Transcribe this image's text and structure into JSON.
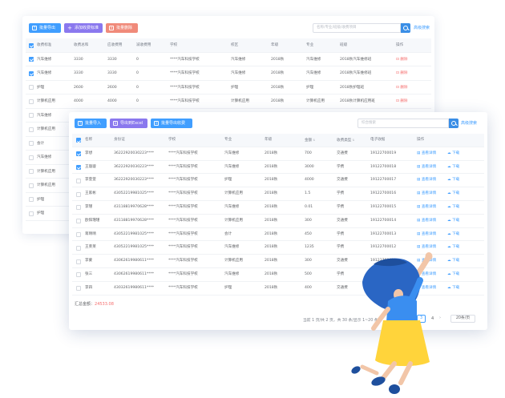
{
  "back_panel": {
    "toolbar": {
      "import_label": "批量导出",
      "add_label": "添加收费标准",
      "delete_label": "批量删除"
    },
    "search": {
      "placeholder": "名称/专业/班级/收费项目",
      "advanced_label": "高级搜索"
    },
    "columns": [
      "收费标准",
      "收费总和",
      "应收费用",
      "减收费用",
      "学校",
      "校区",
      "年级",
      "专业",
      "班级",
      "操作"
    ],
    "rows": [
      {
        "checked": true,
        "name": "汽车维修",
        "total": "3330",
        "due": "3330",
        "reduce": "0",
        "school": "****汽车科技学校",
        "campus": "汽车维修",
        "grade": "2018秋",
        "major": "汽车维修",
        "class": "2018秋汽车维修班",
        "action": "删除"
      },
      {
        "checked": true,
        "name": "汽车维修",
        "total": "3330",
        "due": "3330",
        "reduce": "0",
        "school": "****汽车科技学校",
        "campus": "汽车维修",
        "grade": "2018秋",
        "major": "汽车维修",
        "class": "2018秋汽车维修班",
        "action": "删除"
      },
      {
        "checked": false,
        "name": "护理",
        "total": "2600",
        "due": "2600",
        "reduce": "0",
        "school": "****汽车科技学校",
        "campus": "护理",
        "grade": "2018秋",
        "major": "护理",
        "class": "2018秋护理班",
        "action": "删除"
      },
      {
        "checked": false,
        "name": "计算机应用",
        "total": "4000",
        "due": "4000",
        "reduce": "0",
        "school": "****汽车科技学校",
        "campus": "计算机应用",
        "grade": "2018秋",
        "major": "计算机应用",
        "class": "2018秋计算机应用班",
        "action": "删除"
      },
      {
        "checked": false,
        "name": "汽车维修"
      },
      {
        "checked": false,
        "name": "计算机应用"
      },
      {
        "checked": false,
        "name": "会计"
      },
      {
        "checked": false,
        "name": "汽车维修"
      },
      {
        "checked": false,
        "name": "计算机应用"
      },
      {
        "checked": false,
        "name": "计算机应用"
      },
      {
        "checked": false,
        "name": "护理"
      },
      {
        "checked": false,
        "name": "护理"
      }
    ]
  },
  "front_panel": {
    "toolbar": {
      "import_label": "批量导入",
      "export_label": "导出到Excel",
      "batch_export_label": "批量导出收费"
    },
    "search": {
      "placeholder": "综合搜索",
      "advanced_label": "高级搜索"
    },
    "columns": [
      "名称",
      "身份证",
      "学校",
      "专业",
      "年级",
      "金额",
      "收费类型",
      "电子收据",
      "操作"
    ],
    "view_label": "查看详情",
    "download_label": "下载",
    "rows": [
      {
        "checked": true,
        "name": "李想",
        "id": "36222920030223****",
        "school": "****汽车科技学校",
        "major": "汽车维修",
        "grade": "2018秋",
        "amount": "700",
        "type": "交通费",
        "receipt": "19122700019"
      },
      {
        "checked": true,
        "name": "王璇璇",
        "id": "36222920030223****",
        "school": "****汽车科技学校",
        "major": "汽车维修",
        "grade": "2018秋",
        "amount": "3000",
        "type": "学费",
        "receipt": "19122700018"
      },
      {
        "checked": false,
        "name": "李萱萱",
        "id": "36222920030223****",
        "school": "****汽车科技学校",
        "major": "护理",
        "grade": "2018秋",
        "amount": "4000",
        "type": "交通费",
        "receipt": "19122700017"
      },
      {
        "checked": false,
        "name": "王家彬",
        "id": "43052219981025****",
        "school": "****汽车科技学校",
        "major": "计算机应用",
        "grade": "2018秋",
        "amount": "1.5",
        "type": "学费",
        "receipt": "19122700016"
      },
      {
        "checked": false,
        "name": "李瑾",
        "id": "43118819970628****",
        "school": "****汽车科技学校",
        "major": "汽车维修",
        "grade": "2018秋",
        "amount": "0.01",
        "type": "学费",
        "receipt": "19122700015"
      },
      {
        "checked": false,
        "name": "欧阳瑾瑾",
        "id": "43118819970628****",
        "school": "****汽车科技学校",
        "major": "计算机应用",
        "grade": "2018秋",
        "amount": "300",
        "type": "交通费",
        "receipt": "19122700014"
      },
      {
        "checked": false,
        "name": "蒋晴晴",
        "id": "43052219981025****",
        "school": "****汽车科技学校",
        "major": "会计",
        "grade": "2018秋",
        "amount": "450",
        "type": "学费",
        "receipt": "19122700013"
      },
      {
        "checked": false,
        "name": "王莱莱",
        "id": "43052219981025****",
        "school": "****汽车科技学校",
        "major": "汽车维修",
        "grade": "2018秋",
        "amount": "1235",
        "type": "学费",
        "receipt": "19122700012"
      },
      {
        "checked": false,
        "name": "李蒙",
        "id": "43062619980611****",
        "school": "****汽车科技学校",
        "major": "计算机应用",
        "grade": "2018秋",
        "amount": "300",
        "type": "交通费",
        "receipt": "19122700011"
      },
      {
        "checked": false,
        "name": "张三",
        "id": "43062619980611****",
        "school": "****汽车科技学校",
        "major": "汽车维修",
        "grade": "2018秋",
        "amount": "500",
        "type": "学费",
        "receipt": "19122700010"
      },
      {
        "checked": false,
        "name": "李四",
        "id": "43032619980611****",
        "school": "****汽车科技学校",
        "major": "护理",
        "grade": "2018秋",
        "amount": "400",
        "type": "交通费",
        "receipt": "19122700009"
      }
    ],
    "summary": {
      "label": "汇总金额：",
      "value": "24533.08"
    },
    "pagination": {
      "info": "当前 1 页/共 2 页，共 30 条/显示 1~20 条",
      "pages": [
        "2",
        "3",
        "4"
      ],
      "current": "3",
      "page_size": "20条/页"
    }
  },
  "colors": {
    "primary": "#409eff",
    "purple": "#8a78ee",
    "danger": "#f56c6c",
    "illustration_blue": "#2867c9",
    "illustration_yellow": "#ffd43b"
  },
  "icons": [
    "upload-icon",
    "plus-icon",
    "trash-icon",
    "search-icon",
    "excel-icon",
    "export-icon",
    "view-icon",
    "cloud-download-icon",
    "sort-icon"
  ]
}
